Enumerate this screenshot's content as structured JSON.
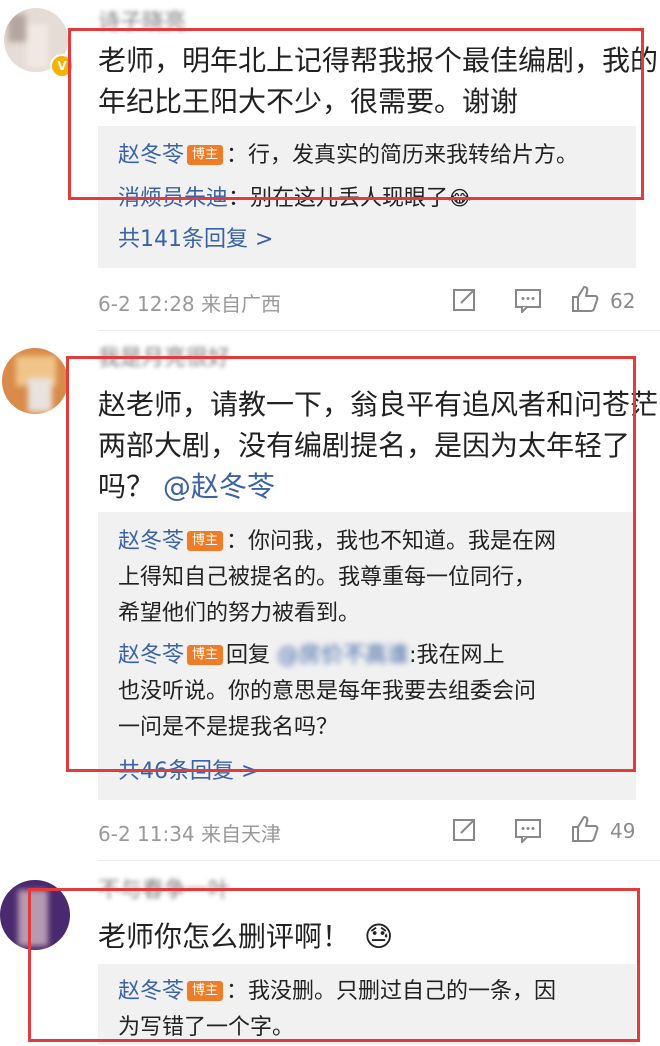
{
  "comments": [
    {
      "username": "诗子晓亮",
      "text_lines": [
        "老师，明年北上记得帮我报个最佳编剧，我的",
        "年纪比王阳大不少，很需要。谢谢"
      ],
      "replies": [
        {
          "author": "赵冬苓",
          "badge": "博主",
          "text": "：行，发真实的简历来我转给片方。"
        },
        {
          "author": "消烦员朱迪",
          "text": "：别在这儿丢人现眼了",
          "emoji": "😂"
        }
      ],
      "more_replies": "共141条回复 >",
      "date": "6-2 12:28",
      "source": "来自广西",
      "likes": "62"
    },
    {
      "username": "我是月亮很好",
      "text_lines": [
        "赵老师，请教一下，翁良平有追风者和问苍茫",
        "两部大剧，没有编剧提名，是因为太年轻了"
      ],
      "text_line3": "吗？",
      "mention": "@赵冬苓",
      "replies": [
        {
          "author": "赵冬苓",
          "badge": "博主",
          "lines": [
            "：你问我，我也不知道。我是在网",
            "上得知自己被提名的。我尊重每一位同行，",
            "希望他们的努力被看到。"
          ]
        },
        {
          "author": "赵冬苓",
          "badge": "博主",
          "reply_word": "回复",
          "blur_target": "@房价不高谁",
          "lines": [
            ":我在网上",
            "也没听说。你的意思是每年我要去组委会问",
            "一问是不是提我名吗？"
          ]
        }
      ],
      "more_replies": "共46条回复 >",
      "date": "6-2 11:34",
      "source": "来自天津",
      "likes": "49"
    },
    {
      "username": "不与春争一叶",
      "text": "老师你怎么删评啊！",
      "emoji": "😓",
      "replies": [
        {
          "author": "赵冬苓",
          "badge": "博主",
          "lines": [
            "：我没删。只删过自己的一条，因",
            "为写错了一个字。"
          ]
        }
      ]
    }
  ],
  "colors": {
    "accent_link": "#3a62a6",
    "highlight_border": "#e13b3b",
    "badge": "#ef7d28"
  }
}
